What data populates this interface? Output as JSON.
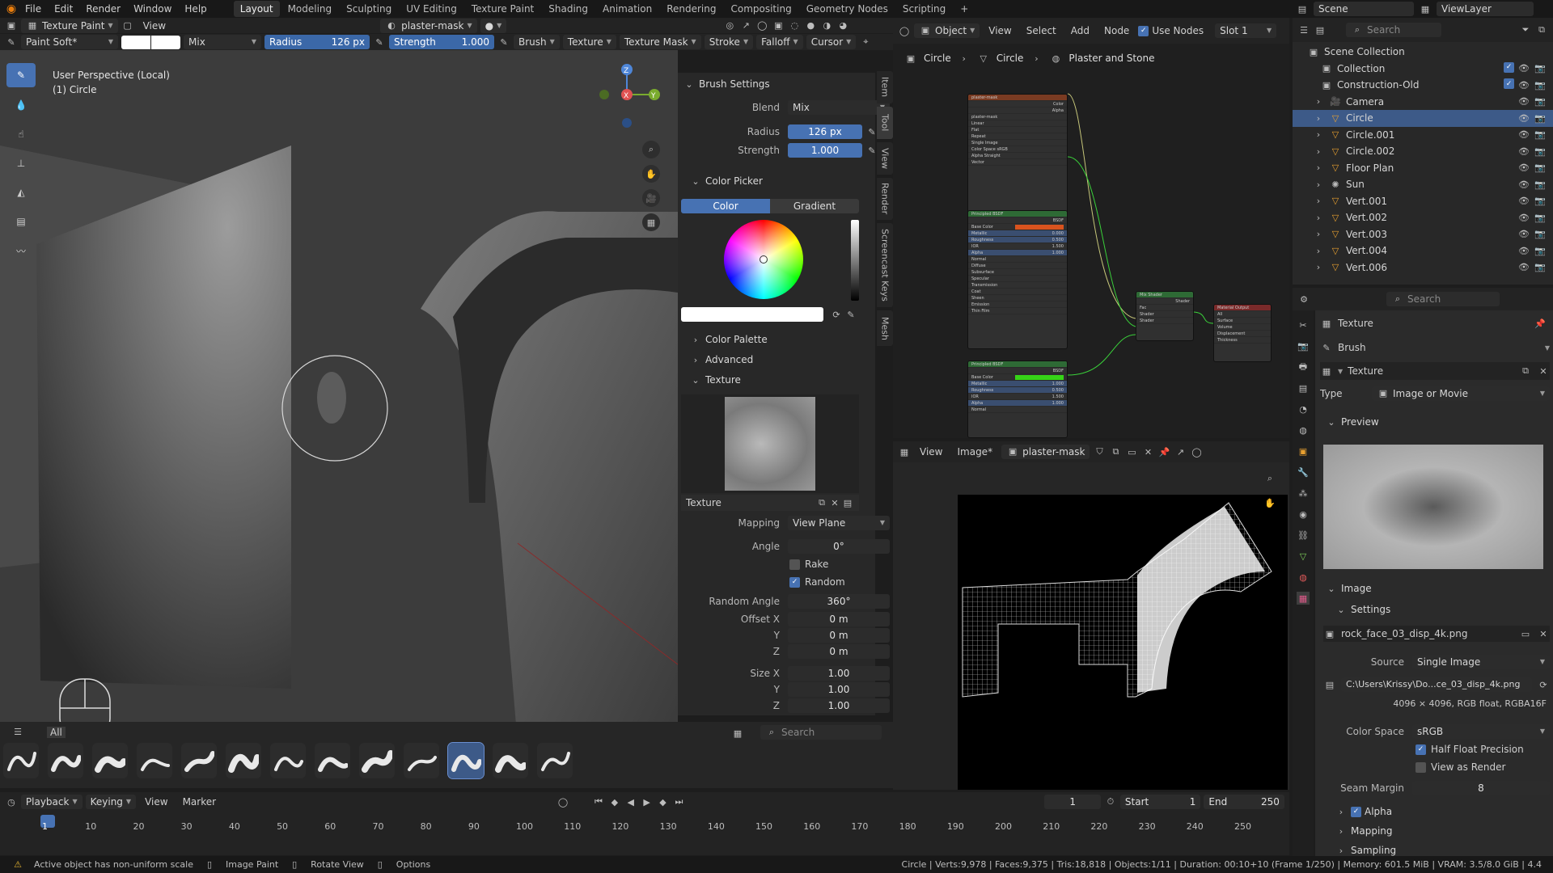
{
  "menu": {
    "items": [
      "File",
      "Edit",
      "Render",
      "Window",
      "Help"
    ],
    "workspaces": [
      "Layout",
      "Modeling",
      "Sculpting",
      "UV Editing",
      "Texture Paint",
      "Shading",
      "Animation",
      "Rendering",
      "Compositing",
      "Geometry Nodes",
      "Scripting"
    ],
    "active_workspace": "Layout",
    "scene": "Scene",
    "view_layer": "ViewLayer",
    "add_tab": "+"
  },
  "viewport_header": {
    "mode": "Texture Paint",
    "view": "View",
    "image": "plaster-mask"
  },
  "tool_settings": {
    "brush": "Paint Soft*",
    "blend": "Mix",
    "radius_label": "Radius",
    "radius_value": "126 px",
    "strength_label": "Strength",
    "strength_value": "1.000",
    "brush_menu": "Brush",
    "texture_menu": "Texture",
    "texture_mask_menu": "Texture Mask",
    "stroke_menu": "Stroke",
    "falloff_menu": "Falloff",
    "cursor_menu": "Cursor"
  },
  "viewport": {
    "perspective": "User Perspective (Local)",
    "object": "(1) Circle",
    "axes": {
      "x": "X",
      "y": "Y",
      "z": "Z"
    }
  },
  "brush_panel": {
    "title": "Brush Settings",
    "blend_label": "Blend",
    "blend_value": "Mix",
    "radius_label": "Radius",
    "radius_value": "126 px",
    "strength_label": "Strength",
    "strength_value": "1.000",
    "color_picker": "Color Picker",
    "color_tab": "Color",
    "gradient_tab": "Gradient",
    "color_palette": "Color Palette",
    "advanced": "Advanced",
    "texture_section": "Texture",
    "texture_name": "Texture",
    "mapping_label": "Mapping",
    "mapping_value": "View Plane",
    "angle_label": "Angle",
    "angle_value": "0°",
    "rake_label": "Rake",
    "random_label": "Random",
    "random_angle_label": "Random Angle",
    "random_angle_value": "360°",
    "offset_x_label": "Offset X",
    "offset_x": "0 m",
    "offset_y_label": "Y",
    "offset_y": "0 m",
    "offset_z_label": "Z",
    "offset_z": "0 m",
    "size_x_label": "Size X",
    "size_x": "1.00",
    "size_y_label": "Y",
    "size_y": "1.00",
    "size_z_label": "Z",
    "size_z": "1.00",
    "side_tabs": [
      "Item",
      "Tool",
      "View",
      "Render",
      "Screencast Keys",
      "Mesh"
    ]
  },
  "asset_shelf": {
    "all_label": "All",
    "search_placeholder": "Search",
    "brush_count": 13,
    "selected_index": 10
  },
  "node_editor": {
    "header_mode": "Object",
    "view": "View",
    "select": "Select",
    "add": "Add",
    "node": "Node",
    "use_nodes": "Use Nodes",
    "slot": "Slot 1",
    "breadcrumb": [
      "Circle",
      "Circle",
      "Plaster and Stone"
    ],
    "nodes": {
      "image_title": "plaster-mask",
      "image_rows": [
        "plaster-mask",
        "Linear",
        "Flat",
        "Repeat",
        "Single Image",
        "Color Space sRGB",
        "Alpha   Straight",
        "Vector"
      ],
      "image_outputs": [
        "Color",
        "Alpha"
      ],
      "bsdf1_title": "Principled BSDF",
      "bsdf_rows": [
        "BSDF",
        "Base Color",
        "Metallic",
        "Roughness",
        "IOR",
        "Alpha",
        "Normal",
        "Diffuse",
        "Subsurface",
        "Specular",
        "Transmission",
        "Coat",
        "Sheen",
        "Emission",
        "Thin Film"
      ],
      "bsdf2_title": "Principled BSDF",
      "bsdf2_rows": [
        "BSDF",
        "Base Color",
        "Metallic",
        "Roughness",
        "IOR",
        "Alpha",
        "Normal"
      ],
      "bsdf_values": [
        "0.000",
        "0.500",
        "1.500",
        "1.000"
      ],
      "bsdf2_values": [
        "1.000",
        "0.500",
        "1.500",
        "1.000"
      ],
      "mix_title": "Mix Shader",
      "mix_rows": [
        "Shader",
        "Fac",
        "Shader",
        "Shader"
      ],
      "output_title": "Material Output",
      "output_rows": [
        "All",
        "Surface",
        "Volume",
        "Displacement",
        "Thickness"
      ],
      "colors": {
        "orange": "#d9531e",
        "green": "#36d417"
      }
    }
  },
  "image_editor": {
    "view": "View",
    "image_menu": "Image*",
    "image_name": "plaster-mask"
  },
  "outliner": {
    "search_placeholder": "Search",
    "root": "Scene Collection",
    "items": [
      {
        "name": "Collection",
        "type": "collection"
      },
      {
        "name": "Construction-Old",
        "type": "collection"
      },
      {
        "name": "Camera",
        "type": "camera"
      },
      {
        "name": "Circle",
        "type": "mesh",
        "selected": true
      },
      {
        "name": "Circle.001",
        "type": "mesh"
      },
      {
        "name": "Circle.002",
        "type": "mesh"
      },
      {
        "name": "Floor Plan",
        "type": "mesh"
      },
      {
        "name": "Sun",
        "type": "light"
      },
      {
        "name": "Vert.001",
        "type": "mesh"
      },
      {
        "name": "Vert.002",
        "type": "mesh"
      },
      {
        "name": "Vert.003",
        "type": "mesh"
      },
      {
        "name": "Vert.004",
        "type": "mesh"
      },
      {
        "name": "Vert.006",
        "type": "mesh"
      }
    ]
  },
  "properties": {
    "search_placeholder": "Search",
    "header": "Texture",
    "brush_label": "Brush",
    "texture_block": "Texture",
    "type_label": "Type",
    "type_value": "Image or Movie",
    "preview_label": "Preview",
    "image_label": "Image",
    "settings_label": "Settings",
    "image_file": "rock_face_03_disp_4k.png",
    "source_label": "Source",
    "source_value": "Single Image",
    "path": "C:\\Users\\Krissy\\Do...ce_03_disp_4k.png",
    "info": "4096 × 4096,  RGB float,  RGBA16F",
    "color_space_label": "Color Space",
    "color_space_value": "sRGB",
    "half_float": "Half Float Precision",
    "view_as_render": "View as Render",
    "seam_margin_label": "Seam Margin",
    "seam_margin_value": "8",
    "alpha": "Alpha",
    "mapping": "Mapping",
    "sampling": "Sampling"
  },
  "timeline": {
    "playback": "Playback",
    "keying": "Keying",
    "view": "View",
    "marker": "Marker",
    "current_frame": "1",
    "start_label": "Start",
    "start": "1",
    "end_label": "End",
    "end": "250",
    "ticks": [
      "1",
      "10",
      "20",
      "30",
      "40",
      "50",
      "60",
      "70",
      "80",
      "90",
      "100",
      "110",
      "120",
      "130",
      "140",
      "150",
      "160",
      "170",
      "180",
      "190",
      "200",
      "210",
      "220",
      "230",
      "240",
      "250"
    ]
  },
  "status": {
    "warning": "Active object has non-uniform scale",
    "left_hint": "Image Paint",
    "mid_hint": "Rotate View",
    "right_hint": "Options",
    "stats": "Circle | Verts:9,978 | Faces:9,375 | Tris:18,818 | Objects:1/11 | Duration: 00:10+10 (Frame 1/250) | Memory: 601.5 MiB | VRAM: 3.5/8.0 GiB | 4.4"
  }
}
